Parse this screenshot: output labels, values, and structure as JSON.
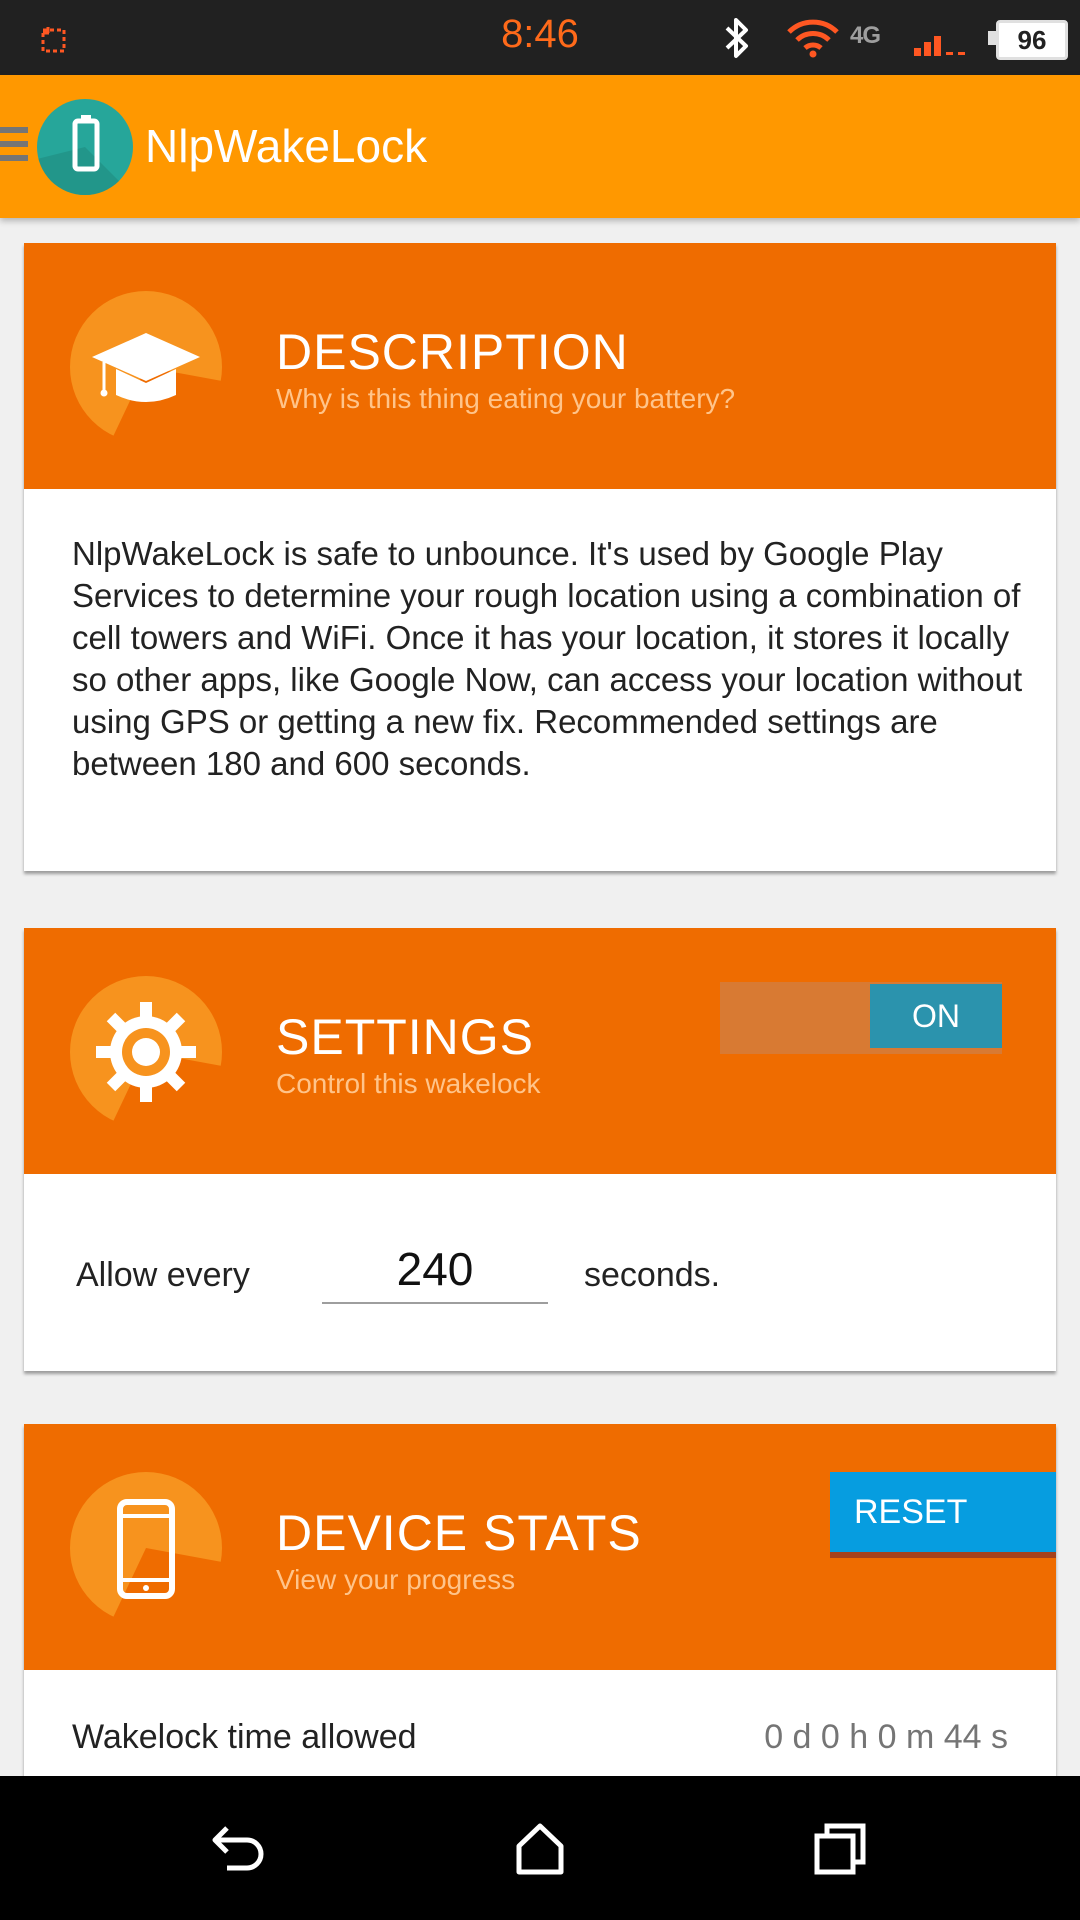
{
  "status_bar": {
    "time": "8:46",
    "network": "4G",
    "battery": "96",
    "icons": [
      "screenshot-icon",
      "bluetooth-icon",
      "wifi-icon",
      "signal-icon",
      "battery-icon"
    ]
  },
  "app_bar": {
    "title": "NlpWakeLock",
    "icons": [
      "menu-icon",
      "battery-logo-icon"
    ]
  },
  "description_card": {
    "title": "DESCRIPTION",
    "subtitle": "Why is this thing eating your battery?",
    "icon": "graduation-cap-icon",
    "body": "NlpWakeLock is safe to unbounce.  It's used by Google Play Services to determine your rough location using a combination of cell towers and WiFi.  Once it has your location, it stores it locally so other apps, like Google Now, can access your location without using GPS or getting a new fix.  Recommended settings are between 180 and 600 seconds."
  },
  "settings_card": {
    "title": "SETTINGS",
    "subtitle": "Control this wakelock",
    "icon": "gear-icon",
    "toggle_label": "ON",
    "toggle_state": true,
    "allow_label": "Allow every",
    "allow_value": "240",
    "allow_unit": "seconds."
  },
  "stats_card": {
    "title": "DEVICE STATS",
    "subtitle": "View your progress",
    "icon": "phone-icon",
    "reset_label": "RESET",
    "rows": [
      {
        "label": "Wakelock time allowed",
        "value": "0 d 0 h 0 m 44 s"
      }
    ]
  },
  "nav_bar": {
    "icons": [
      "back-icon",
      "home-icon",
      "recents-icon"
    ]
  },
  "colors": {
    "app_bar": "#ff9800",
    "card_header": "#ef6c00",
    "toggle_on": "#2b93ad",
    "reset_button": "#069de0",
    "status_time": "#ff6a1a"
  }
}
